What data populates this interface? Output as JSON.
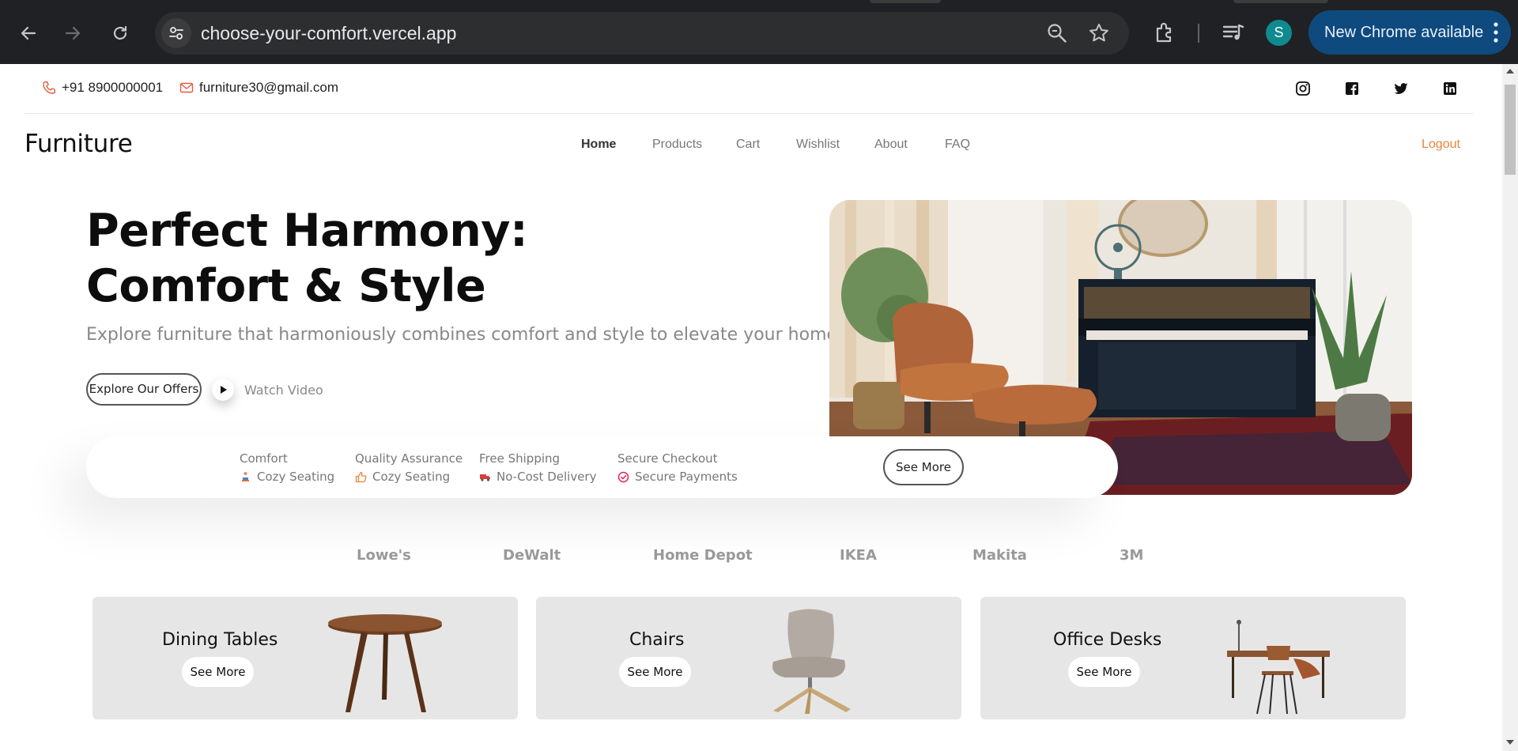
{
  "browser": {
    "url": "choose-your-comfort.vercel.app",
    "profile_initial": "S",
    "update_label": "New Chrome available"
  },
  "topbar": {
    "phone": "+91 8900000001",
    "email": "furniture30@gmail.com",
    "socials": [
      "instagram-icon",
      "facebook-icon",
      "twitter-icon",
      "linkedin-icon"
    ]
  },
  "header": {
    "brand": "Furniture",
    "nav": [
      "Home",
      "Products",
      "Cart",
      "Wishlist",
      "About",
      "FAQ"
    ],
    "active": "Home",
    "logout": "Logout"
  },
  "hero": {
    "title_line1": "Perfect Harmony:",
    "title_line2": "Comfort & Style",
    "subtitle": "Explore furniture that harmoniously combines comfort and style to elevate your home",
    "cta": "Explore Our Offers",
    "video": "Watch Video"
  },
  "features": [
    {
      "title": "Comfort",
      "sub": "Cozy Seating",
      "icon": "person-seat-icon"
    },
    {
      "title": "Quality Assurance",
      "sub": "Cozy Seating",
      "icon": "thumbs-up-icon"
    },
    {
      "title": "Free Shipping",
      "sub": "No-Cost Delivery",
      "icon": "truck-icon"
    },
    {
      "title": "Secure Checkout",
      "sub": "Secure Payments",
      "icon": "check-circle-icon"
    }
  ],
  "features_button": "See More",
  "brands": [
    "Lowe's",
    "DeWalt",
    "Home Depot",
    "IKEA",
    "Makita",
    "3M"
  ],
  "categories": [
    {
      "name": "Dining Tables",
      "button": "See More"
    },
    {
      "name": "Chairs",
      "button": "See More"
    },
    {
      "name": "Office Desks",
      "button": "See More"
    }
  ],
  "colors": {
    "accent": "#e8843c",
    "card_bg": "#e6e6e6",
    "chrome_bg": "#202124"
  }
}
